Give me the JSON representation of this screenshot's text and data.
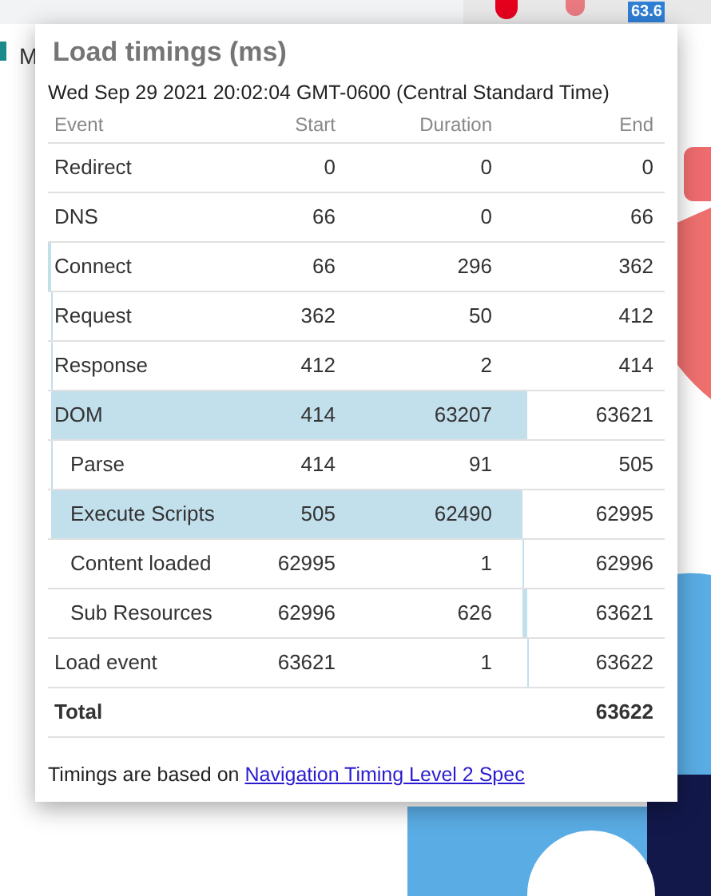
{
  "browser": {
    "bookmark_label": "M",
    "extension_badge": "63.6"
  },
  "popup": {
    "title": "Load timings (ms)",
    "timestamp": "Wed Sep 29 2021 20:02:04 GMT-0600 (Central Standard Time)",
    "table": {
      "columns": [
        "Event",
        "Start",
        "Duration",
        "End"
      ],
      "rows": [
        {
          "event": "Redirect",
          "start": "0",
          "duration": "0",
          "end": "0"
        },
        {
          "event": "DNS",
          "start": "66",
          "duration": "0",
          "end": "66"
        },
        {
          "event": "Connect",
          "start": "66",
          "duration": "296",
          "end": "362"
        },
        {
          "event": "Request",
          "start": "362",
          "duration": "50",
          "end": "412"
        },
        {
          "event": "Response",
          "start": "412",
          "duration": "2",
          "end": "414"
        },
        {
          "event": "DOM",
          "start": "414",
          "duration": "63207",
          "end": "63621",
          "children": [
            {
              "event": "Parse",
              "start": "414",
              "duration": "91",
              "end": "505"
            },
            {
              "event": "Execute Scripts",
              "start": "505",
              "duration": "62490",
              "end": "62995"
            },
            {
              "event": "Content loaded",
              "start": "62995",
              "duration": "1",
              "end": "62996"
            },
            {
              "event": "Sub Resources",
              "start": "62996",
              "duration": "626",
              "end": "63621"
            }
          ]
        },
        {
          "event": "Load event",
          "start": "63621",
          "duration": "1",
          "end": "63622"
        }
      ],
      "total": {
        "label": "Total",
        "value": "63622"
      }
    },
    "footer": {
      "text": "Timings are based on",
      "link": "Navigation Timing Level 2 Spec"
    }
  }
}
